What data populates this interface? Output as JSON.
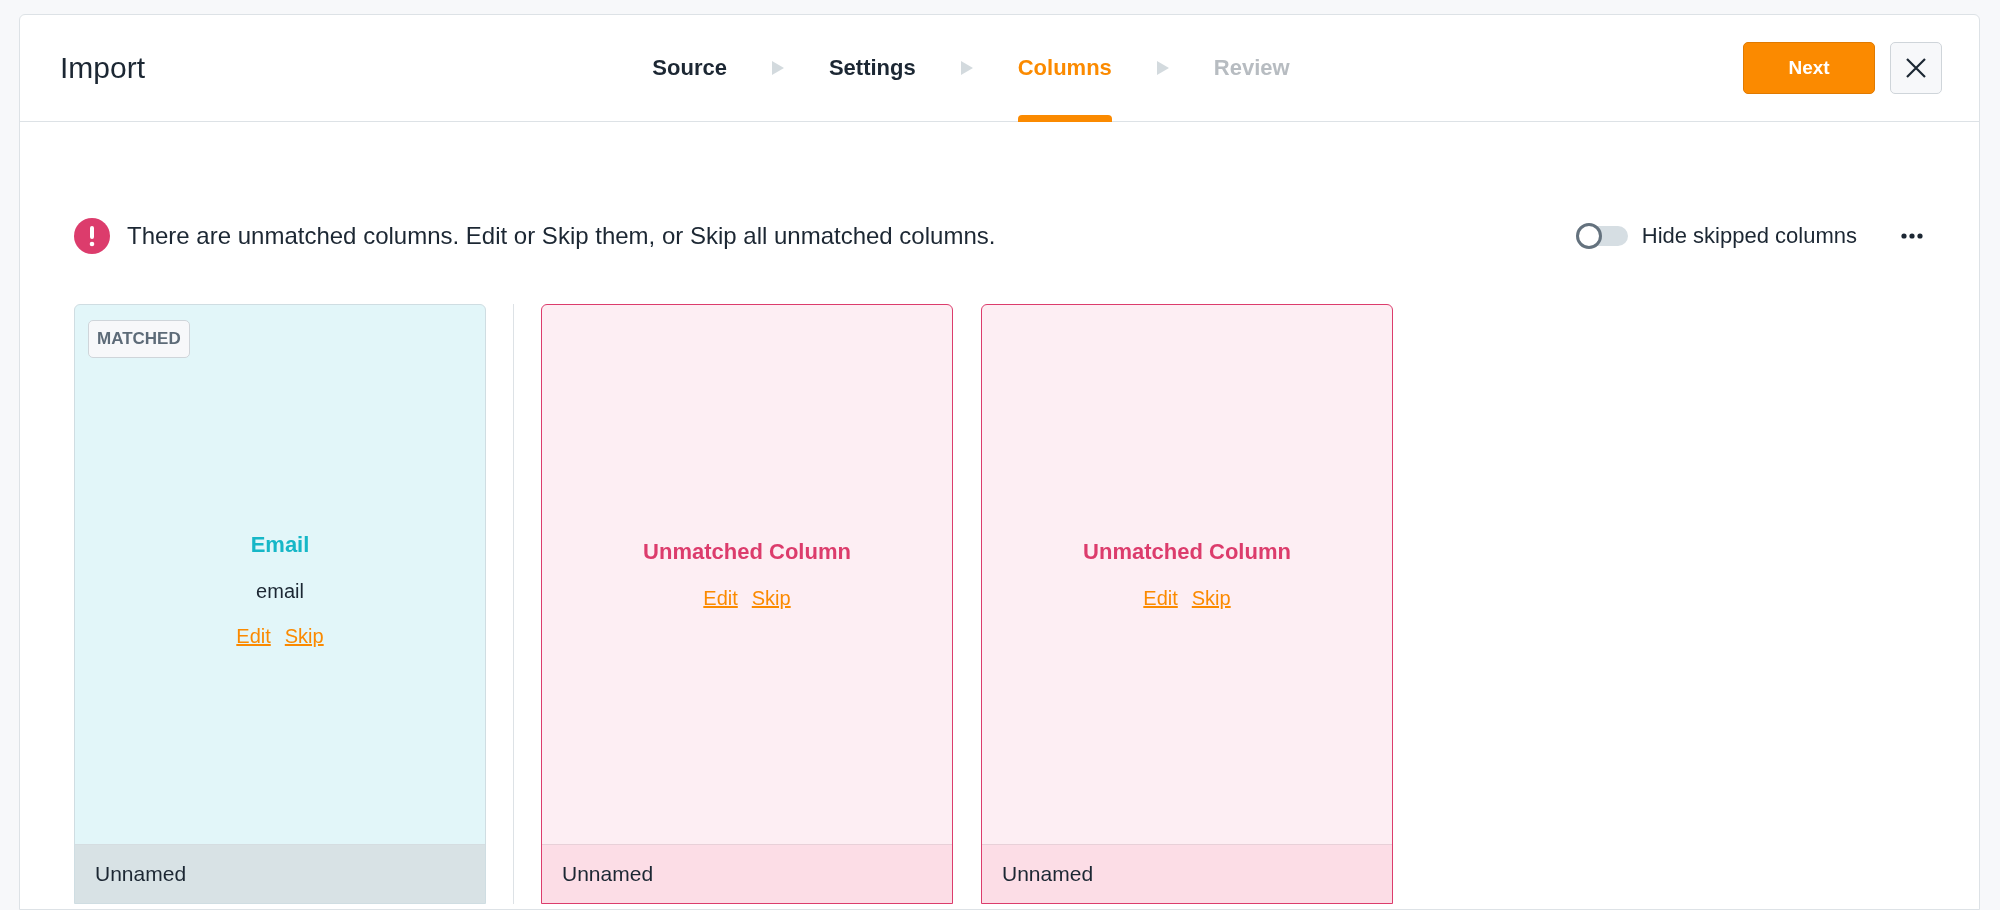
{
  "window": {
    "title": "Import"
  },
  "steps": [
    {
      "label": "Source",
      "selected": false,
      "disabled": false
    },
    {
      "label": "Settings",
      "selected": false,
      "disabled": false
    },
    {
      "label": "Columns",
      "selected": true,
      "disabled": false
    },
    {
      "label": "Review",
      "selected": false,
      "disabled": true
    }
  ],
  "buttons": {
    "next": "Next"
  },
  "alert": {
    "message": "There are unmatched columns. Edit or Skip them, or Skip all unmatched columns."
  },
  "hide_skipped": {
    "label": "Hide skipped columns",
    "on": false
  },
  "columns": [
    {
      "kind": "matched",
      "badge": "MATCHED",
      "title": "Email",
      "field": "email",
      "actions": [
        "Edit",
        "Skip"
      ],
      "footer": "Unnamed"
    },
    {
      "kind": "unmatched",
      "title": "Unmatched Column",
      "actions": [
        "Edit",
        "Skip"
      ],
      "footer": "Unnamed"
    },
    {
      "kind": "unmatched",
      "title": "Unmatched Column",
      "actions": [
        "Edit",
        "Skip"
      ],
      "footer": "Unnamed"
    }
  ]
}
